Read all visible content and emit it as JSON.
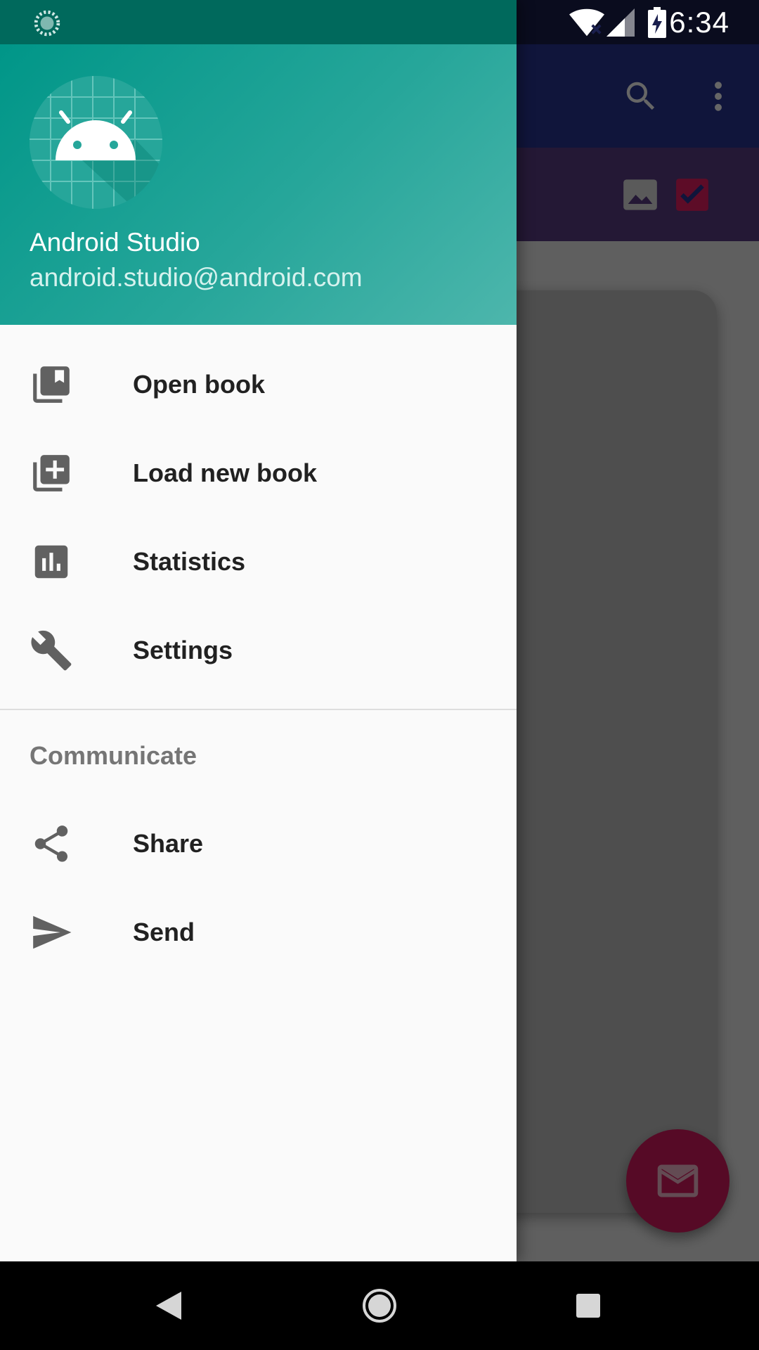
{
  "status_bar": {
    "time": "6:34",
    "icons": [
      "loading-icon",
      "wifi-icon",
      "signal-icon",
      "battery-charging-icon"
    ]
  },
  "drawer": {
    "header": {
      "avatar_icon": "android-logo-icon",
      "user_name": "Android Studio",
      "user_email": "android.studio@android.com"
    },
    "items": [
      {
        "label": "Open book",
        "icon": "library-books-icon"
      },
      {
        "label": "Load new book",
        "icon": "library-add-icon"
      },
      {
        "label": "Statistics",
        "icon": "bar-chart-icon"
      },
      {
        "label": "Settings",
        "icon": "wrench-icon"
      }
    ],
    "section_title": "Communicate",
    "section_items": [
      {
        "label": "Share",
        "icon": "share-icon"
      },
      {
        "label": "Send",
        "icon": "send-icon"
      }
    ]
  },
  "background_app": {
    "toolbar_icons": [
      "search-icon",
      "more-vert-icon"
    ],
    "tab_icons": [
      "image-icon",
      "checkbox-icon"
    ],
    "fab_icon": "mail-icon"
  },
  "navigation_bar": {
    "buttons": [
      "back-icon",
      "home-icon",
      "recents-icon"
    ]
  },
  "colors": {
    "primary": "#283593",
    "accent": "#d81b60",
    "drawer_header": "#009688"
  }
}
